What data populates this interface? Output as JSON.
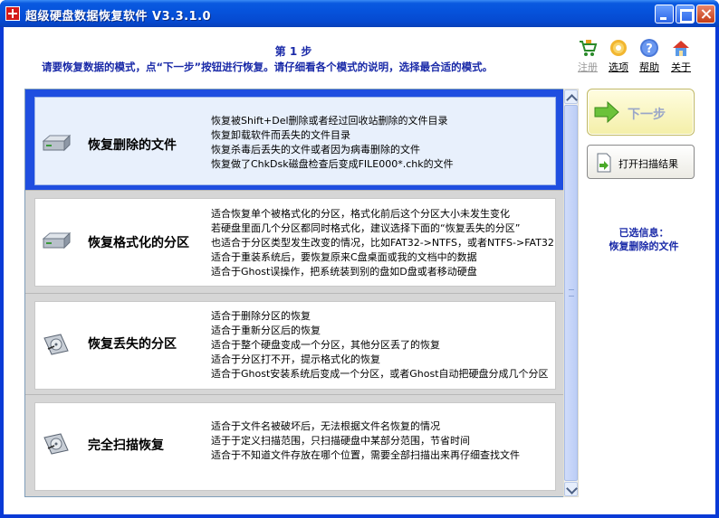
{
  "window": {
    "title": "超级硬盘数据恢复软件 V3.3.1.0"
  },
  "header": {
    "step": "第 1 步",
    "description": "请要恢复数据的模式，点“下一步”按钮进行恢复。请仔细看各个模式的说明，选择最合适的模式。"
  },
  "toolbar": {
    "register": "注册",
    "options": "选项",
    "help": "帮助",
    "about": "关于"
  },
  "modes": [
    {
      "name": "恢复删除的文件",
      "lines": [
        "恢复被Shift+Del删除或者经过回收站删除的文件目录",
        "恢复卸载软件而丢失的文件目录",
        "恢复杀毒后丢失的文件或者因为病毒删除的文件",
        "恢复做了ChkDsk磁盘检查后变成FILE000*.chk的文件"
      ]
    },
    {
      "name": "恢复格式化的分区",
      "lines": [
        "适合恢复单个被格式化的分区，格式化前后这个分区大小未发生变化",
        "若硬盘里面几个分区都同时格式化，建议选择下面的“恢复丢失的分区”",
        "也适合于分区类型发生改变的情况，比如FAT32->NTFS，或者NTFS->FAT32",
        "适合于重装系统后，要恢复原来C盘桌面或我的文档中的数据",
        "适合于Ghost误操作，把系统装到别的盘如D盘或者移动硬盘"
      ]
    },
    {
      "name": "恢复丢失的分区",
      "lines": [
        "适合于删除分区的恢复",
        "适合于重新分区后的恢复",
        "适合于整个硬盘变成一个分区，其他分区丢了的恢复",
        "适合于分区打不开，提示格式化的恢复",
        "适合于Ghost安装系统后变成一个分区，或者Ghost自动把硬盘分成几个分区"
      ]
    },
    {
      "name": "完全扫描恢复",
      "lines": [
        "适合于文件名被破坏后，无法根据文件名恢复的情况",
        "适于于定义扫描范围，只扫描硬盘中某部分范围，节省时间",
        "适合于不知道文件存放在哪个位置，需要全部扫描出来再仔细查找文件"
      ]
    }
  ],
  "actions": {
    "next": "下一步",
    "open_scan": "打开扫描结果"
  },
  "selection": {
    "label": "已选信息：",
    "value": "恢复删除的文件"
  },
  "colors": {
    "accent_text": "#1a2aa8",
    "selected_band": "#1f4ee0",
    "title_bar": "#0653dc"
  }
}
